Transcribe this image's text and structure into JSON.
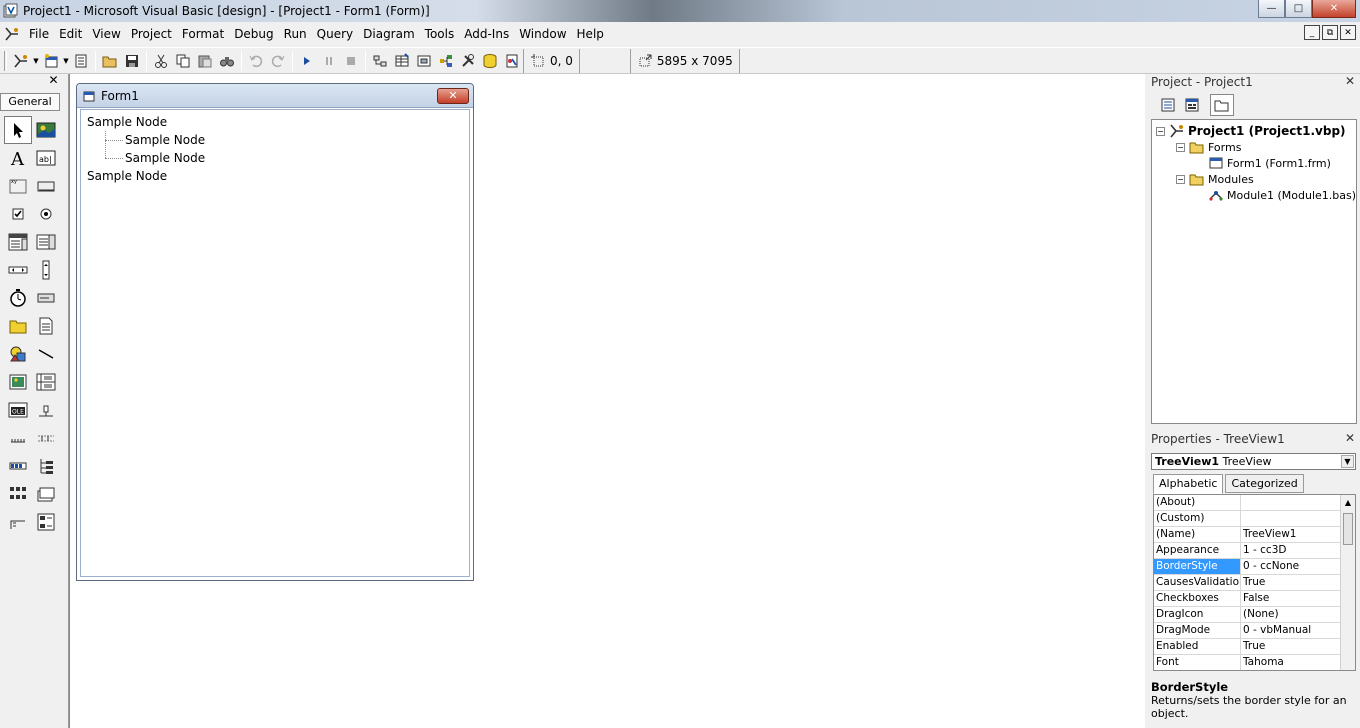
{
  "window": {
    "title": "Project1 - Microsoft Visual Basic [design] - [Project1 - Form1 (Form)]",
    "min_glyph": "—",
    "max_glyph": "□",
    "close_glyph": "✕"
  },
  "menu": {
    "items": [
      "File",
      "Edit",
      "View",
      "Project",
      "Format",
      "Debug",
      "Run",
      "Query",
      "Diagram",
      "Tools",
      "Add-Ins",
      "Window",
      "Help"
    ],
    "mdi_min": "_",
    "mdi_restore": "⧉",
    "mdi_close": "✕"
  },
  "toolbar": {
    "position": "0, 0",
    "size": "5895 x 7095"
  },
  "toolbox": {
    "header": "General",
    "close": "✕",
    "tools": [
      "pointer-icon",
      "picturebox-icon",
      "label-icon",
      "textbox-icon",
      "frame-icon",
      "commandbutton-icon",
      "checkbox-icon",
      "optionbutton-icon",
      "combobox-icon",
      "listbox-icon",
      "hscrollbar-icon",
      "vscrollbar-icon",
      "timer-icon",
      "drivelistbox-icon",
      "dirlistbox-icon",
      "filelistbox-icon",
      "shape-icon",
      "line-icon",
      "image-icon",
      "data-icon",
      "ole-icon",
      "slider-icon",
      "progressbar-icon",
      "statusbar-icon",
      "toolbar-icon",
      "treeview-icon",
      "imagelist-icon",
      "tabstrip-icon",
      "listview-icon",
      "imagecombo-icon"
    ]
  },
  "form": {
    "title": "Form1",
    "close": "✕",
    "tree_nodes": [
      {
        "label": "Sample Node",
        "level": 0
      },
      {
        "label": "Sample Node",
        "level": 1
      },
      {
        "label": "Sample Node",
        "level": 1
      },
      {
        "label": "Sample Node",
        "level": 0
      }
    ]
  },
  "project_explorer": {
    "title": "Project - Project1",
    "close": "✕",
    "nodes": {
      "project": "Project1 (Project1.vbp)",
      "forms": "Forms",
      "form1": "Form1 (Form1.frm)",
      "modules": "Modules",
      "module1": "Module1 (Module1.bas)"
    },
    "expander": "−"
  },
  "properties": {
    "title": "Properties - TreeView1",
    "close": "✕",
    "object_name": "TreeView1",
    "object_type": "TreeView",
    "tabs": [
      "Alphabetic",
      "Categorized"
    ],
    "rows": [
      {
        "name": "(About)",
        "value": ""
      },
      {
        "name": "(Custom)",
        "value": ""
      },
      {
        "name": "(Name)",
        "value": "TreeView1"
      },
      {
        "name": "Appearance",
        "value": "1 - cc3D"
      },
      {
        "name": "BorderStyle",
        "value": "0 - ccNone"
      },
      {
        "name": "CausesValidation",
        "value": "True"
      },
      {
        "name": "Checkboxes",
        "value": "False"
      },
      {
        "name": "DragIcon",
        "value": "(None)"
      },
      {
        "name": "DragMode",
        "value": "0 - vbManual"
      },
      {
        "name": "Enabled",
        "value": "True"
      },
      {
        "name": "Font",
        "value": "Tahoma"
      }
    ],
    "selected_row": 4,
    "description_title": "BorderStyle",
    "description_text": "Returns/sets the border style for an object."
  },
  "colors": {
    "selection": "#3399ff",
    "close_red": "#c43f28"
  }
}
